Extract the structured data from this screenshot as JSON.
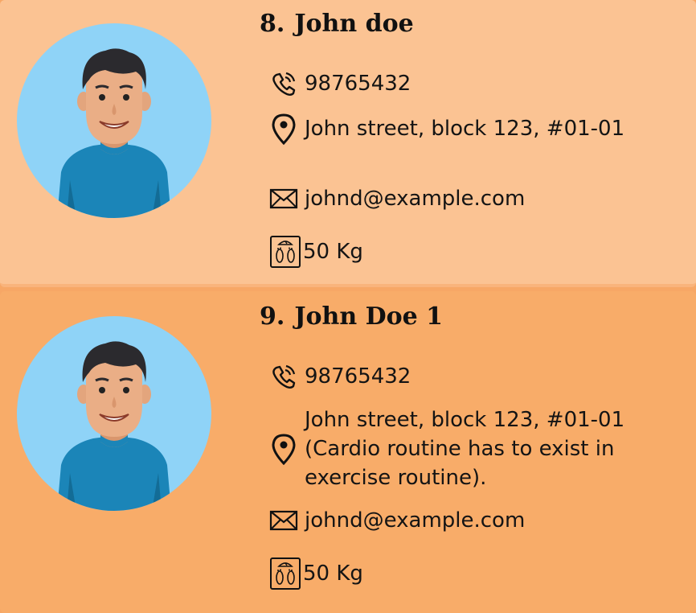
{
  "people": [
    {
      "index": "8.",
      "name": "John doe",
      "phone": "98765432",
      "address": "John street, block 123, #01-01",
      "email": "johnd@example.com",
      "weight": "50 Kg"
    },
    {
      "index": "9.",
      "name": "John Doe 1",
      "phone": "98765432",
      "address": "John street, block 123, #01-01 (Cardio routine has to exist in exercise routine).",
      "email": "johnd@example.com",
      "weight": "50 Kg"
    }
  ],
  "icons": {
    "phone": "phone-icon",
    "address": "location-pin-icon",
    "email": "envelope-icon",
    "weight": "weighing-scale-icon"
  },
  "colors": {
    "card_light": "#fbc393",
    "card_dark": "#f8ac69",
    "avatar_bg": "#8fd3f7",
    "shirt": "#1b85b8"
  }
}
